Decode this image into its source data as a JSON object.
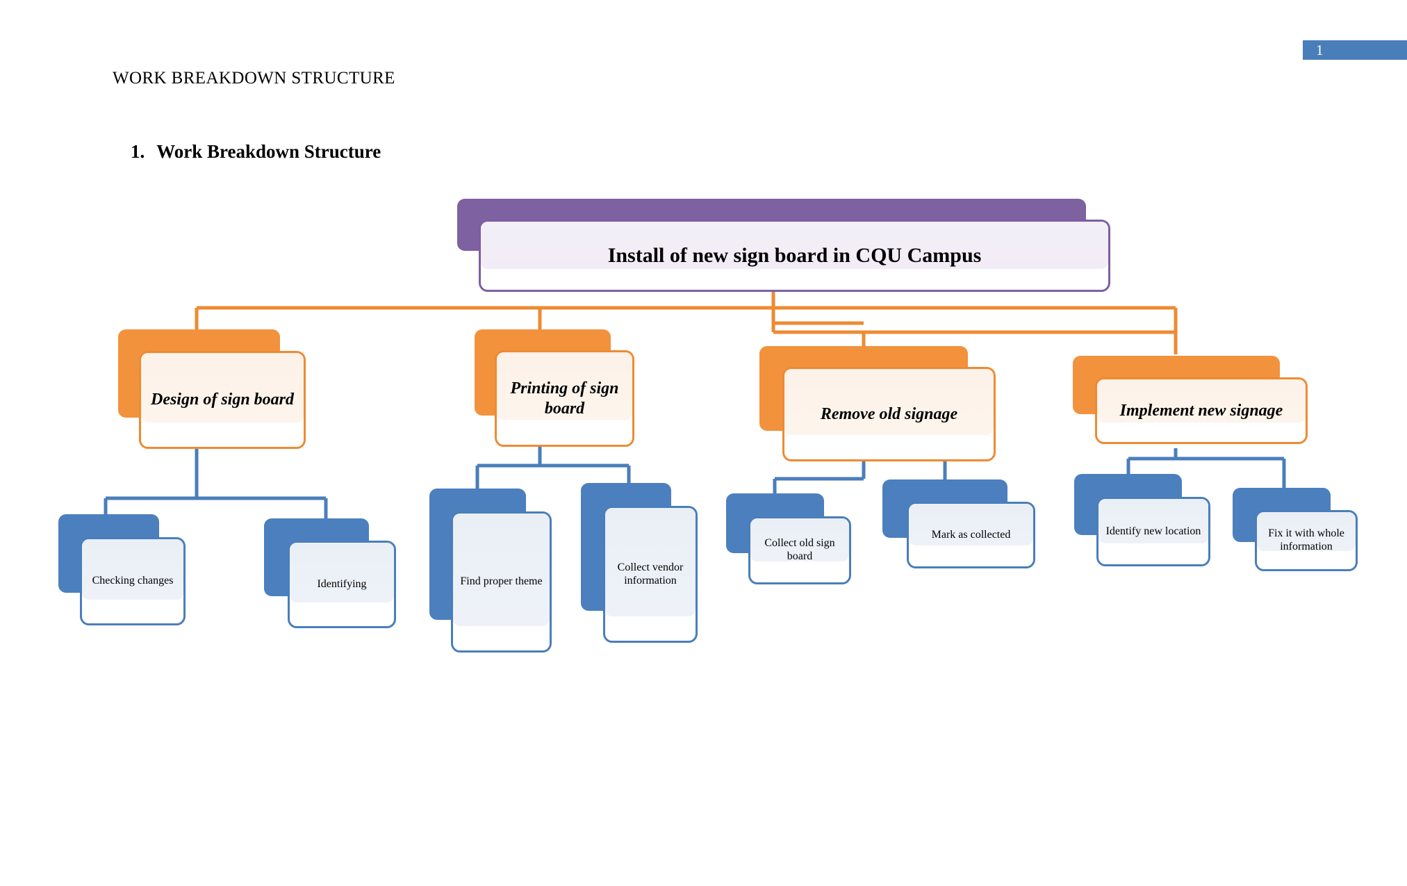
{
  "page": {
    "page_number": "1",
    "header": "WORK BREAKDOWN STRUCTURE",
    "section_number": "1.",
    "section_title": "Work Breakdown Structure"
  },
  "colors": {
    "root_fill": "#7d61a0",
    "root_border": "#7d5fa3",
    "root_tint": "#f3eff7",
    "level2_fill": "#f2923d",
    "level2_border": "#ed8b33",
    "level2_tint": "#fdf2e9",
    "level3_fill": "#4c7fbe",
    "level3_border": "#4a7ebb",
    "level3_tint": "#eaeff6",
    "badge_fill": "#4a7ebb",
    "connector_orange": "#ed8b33",
    "connector_blue": "#4a7ebb"
  },
  "chart_data": {
    "type": "diagram",
    "diagram_kind": "work-breakdown-structure-tree",
    "title": "Work Breakdown Structure",
    "root": {
      "id": "root",
      "label": "Install of new sign board in CQU Campus",
      "level": 1
    },
    "level2": [
      {
        "id": "n1",
        "label": "Design of sign board",
        "level": 2
      },
      {
        "id": "n2",
        "label": "Printing of sign board",
        "level": 2
      },
      {
        "id": "n3",
        "label": "Remove old signage",
        "level": 2
      },
      {
        "id": "n4",
        "label": "Implement new signage",
        "level": 2
      }
    ],
    "level3": [
      {
        "id": "n1a",
        "parent": "n1",
        "label": "Checking changes",
        "level": 3
      },
      {
        "id": "n1b",
        "parent": "n1",
        "label": "Identifying",
        "level": 3
      },
      {
        "id": "n2a",
        "parent": "n2",
        "label": "Find proper theme",
        "level": 3
      },
      {
        "id": "n2b",
        "parent": "n2",
        "label": "Collect vendor information",
        "level": 3
      },
      {
        "id": "n3a",
        "parent": "n3",
        "label": "Collect old sign board",
        "level": 3
      },
      {
        "id": "n3b",
        "parent": "n3",
        "label": "Mark as collected",
        "level": 3
      },
      {
        "id": "n4a",
        "parent": "n4",
        "label": "Identify new location",
        "level": 3
      },
      {
        "id": "n4b",
        "parent": "n4",
        "label": "Fix it with whole information",
        "level": 3
      }
    ]
  }
}
